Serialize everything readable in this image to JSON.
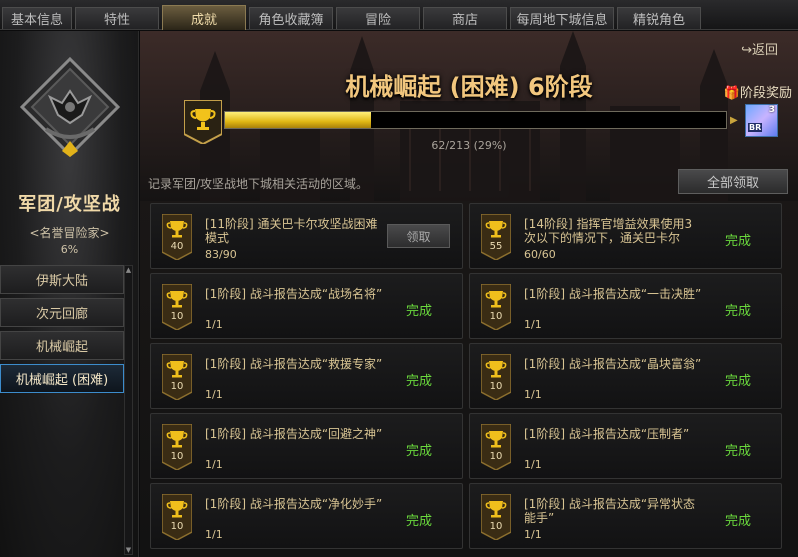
{
  "tabs": [
    {
      "label": "基本信息",
      "active": false
    },
    {
      "label": "特性",
      "active": false
    },
    {
      "label": "成就",
      "active": true
    },
    {
      "label": "角色收藏簿",
      "active": false
    },
    {
      "label": "冒险",
      "active": false
    },
    {
      "label": "商店",
      "active": false
    },
    {
      "label": "每周地下城信息",
      "active": false
    },
    {
      "label": "精锐角色",
      "active": false
    }
  ],
  "sidebar": {
    "emblem_icon": "guild-siege-emblem-icon",
    "title": "军团/攻坚战",
    "subtitle": "<名誉冒险家>",
    "percent": "6%",
    "items": [
      {
        "label": "伊斯大陆",
        "active": false
      },
      {
        "label": "次元回廊",
        "active": false
      },
      {
        "label": "机械崛起",
        "active": false
      },
      {
        "label": "机械崛起 (困难)",
        "active": true
      }
    ]
  },
  "header": {
    "back_label": "返回",
    "title": "机械崛起 (困难) 6阶段",
    "stage_reward_label": "阶段奖励",
    "progress_current": 62,
    "progress_total": 213,
    "progress_text": "62/213 (29%)",
    "reward_count": "3",
    "reward_tag": "BR"
  },
  "description": "记录军团/攻坚战地下城相关活动的区域。",
  "claim_all_label": "全部领取",
  "achievements": [
    {
      "points": "40",
      "title": "[11阶段] 通关巴卡尔攻坚战困难模式",
      "progress": "83/90",
      "status": "领取",
      "claimable": true
    },
    {
      "points": "55",
      "title": "[14阶段] 指挥官增益效果使用3次以下的情况下，通关巴卡尔",
      "progress": "60/60",
      "status": "完成",
      "claimable": false
    },
    {
      "points": "10",
      "title": "[1阶段] 战斗报告达成“战场名将”",
      "progress": "1/1",
      "status": "完成",
      "claimable": false
    },
    {
      "points": "10",
      "title": "[1阶段] 战斗报告达成“一击决胜”",
      "progress": "1/1",
      "status": "完成",
      "claimable": false
    },
    {
      "points": "10",
      "title": "[1阶段] 战斗报告达成“救援专家”",
      "progress": "1/1",
      "status": "完成",
      "claimable": false
    },
    {
      "points": "10",
      "title": "[1阶段] 战斗报告达成“晶块富翁”",
      "progress": "1/1",
      "status": "完成",
      "claimable": false
    },
    {
      "points": "10",
      "title": "[1阶段] 战斗报告达成“回避之神”",
      "progress": "1/1",
      "status": "完成",
      "claimable": false
    },
    {
      "points": "10",
      "title": "[1阶段] 战斗报告达成“压制者”",
      "progress": "1/1",
      "status": "完成",
      "claimable": false
    },
    {
      "points": "10",
      "title": "[1阶段] 战斗报告达成“净化妙手”",
      "progress": "1/1",
      "status": "完成",
      "claimable": false
    },
    {
      "points": "10",
      "title": "[1阶段] 战斗报告达成“异常状态能手”",
      "progress": "1/1",
      "status": "完成",
      "claimable": false
    }
  ]
}
